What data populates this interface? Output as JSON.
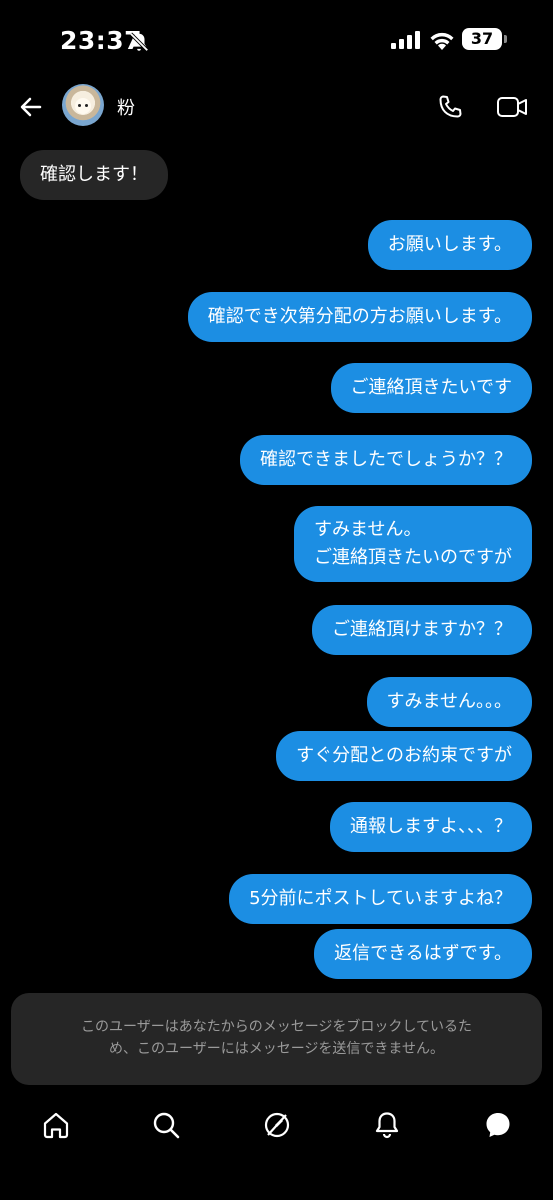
{
  "status": {
    "time": "23:37",
    "battery": "37"
  },
  "header": {
    "contact_name": "粉"
  },
  "messages": [
    {
      "side": "received",
      "text": "確認します！"
    },
    {
      "side": "sent",
      "text": "お願いします。"
    },
    {
      "side": "sent",
      "text": "確認でき次第分配の方お願いします。"
    },
    {
      "side": "sent",
      "text": "ご連絡頂きたいです"
    },
    {
      "side": "sent",
      "text": "確認できましたでしょうか？？"
    },
    {
      "side": "sent",
      "lines": [
        "すみません。",
        "ご連絡頂きたいのですが"
      ]
    },
    {
      "side": "sent",
      "text": "ご連絡頂けますか？？"
    },
    {
      "side": "sent",
      "text": "すみません。。。"
    },
    {
      "side": "sent",
      "text": "すぐ分配とのお約束ですが"
    },
    {
      "side": "sent",
      "text": "通報しますよ、、、？"
    },
    {
      "side": "sent",
      "text": "5分前にポストしていますよね？"
    },
    {
      "side": "sent",
      "text": "返信できるはずです。"
    }
  ],
  "notice": {
    "line1": "このユーザーはあなたからのメッセージをブロックしているた",
    "line2": "め、このユーザーにはメッセージを送信できません。"
  },
  "icons": {
    "back": "arrow-left-icon",
    "call": "phone-icon",
    "video": "video-camera-icon",
    "tabs": [
      "home-icon",
      "search-icon",
      "threads-feed-icon",
      "notifications-icon",
      "messages-icon"
    ]
  }
}
